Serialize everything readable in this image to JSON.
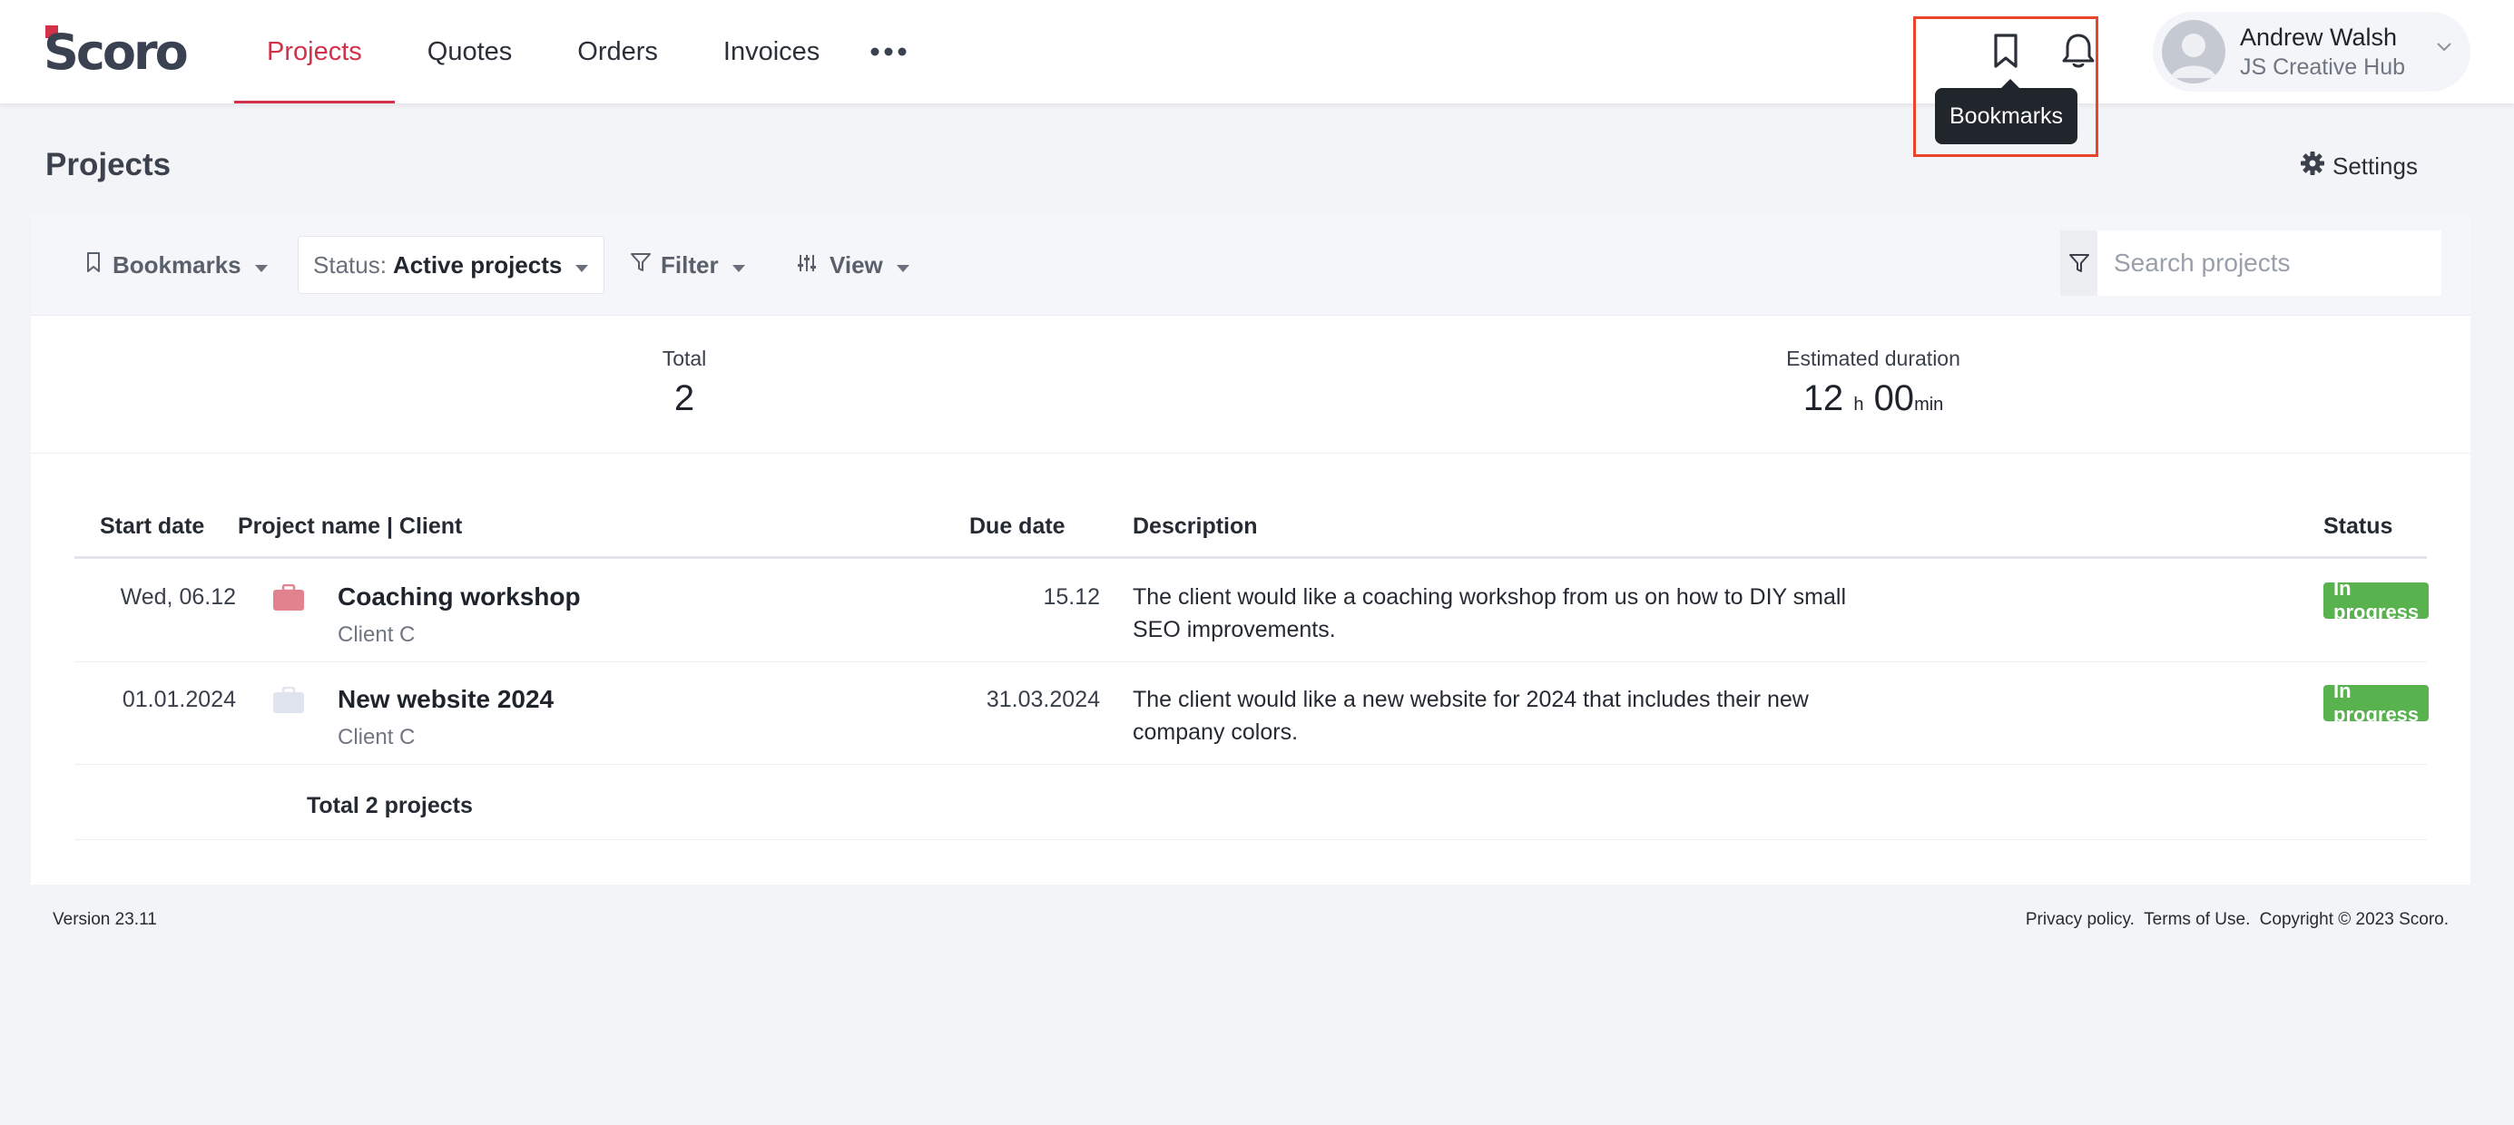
{
  "app": {
    "logo_text": "Scoro",
    "brand_color": "#d2314a"
  },
  "nav": {
    "items": [
      {
        "label": "Projects",
        "active": true
      },
      {
        "label": "Quotes",
        "active": false
      },
      {
        "label": "Orders",
        "active": false
      },
      {
        "label": "Invoices",
        "active": false
      }
    ],
    "more_icon": "more-horizontal-icon"
  },
  "header_actions": {
    "bookmark_icon": "bookmark-icon",
    "bell_icon": "bell-icon",
    "tooltip": "Bookmarks"
  },
  "user": {
    "name": "Andrew Walsh",
    "company": "JS Creative Hub"
  },
  "page": {
    "title": "Projects",
    "settings_label": "Settings"
  },
  "toolbar": {
    "bookmarks_label": "Bookmarks",
    "status_prefix": "Status:",
    "status_value": "Active projects",
    "filter_label": "Filter",
    "view_label": "View",
    "search_placeholder": "Search projects"
  },
  "summary": {
    "total_label": "Total",
    "total_value": "2",
    "duration_label": "Estimated duration",
    "duration_hours": "12",
    "duration_hours_unit": "h",
    "duration_minutes": "00",
    "duration_minutes_unit": "min"
  },
  "table": {
    "headers": {
      "start_date": "Start date",
      "project_client": "Project name | Client",
      "due_date": "Due date",
      "description": "Description",
      "status": "Status"
    },
    "rows": [
      {
        "start_date": "Wed, 06.12",
        "project": "Coaching workshop",
        "client": "Client C",
        "due_date": "15.12",
        "description": "The client would like a coaching workshop from us on how to DIY small SEO improvements.",
        "status": "In progress",
        "icon_color": "#e2828f"
      },
      {
        "start_date": "01.01.2024",
        "project": "New website 2024",
        "client": "Client C",
        "due_date": "31.03.2024",
        "description": "The client would like a new website for 2024 that includes their new company colors.",
        "status": "In progress",
        "icon_color": "#dfe4ee"
      }
    ],
    "total_label": "Total 2 projects"
  },
  "footer": {
    "version": "Version 23.11",
    "privacy": "Privacy policy.",
    "terms": "Terms of Use.",
    "copyright": "Copyright © 2023 Scoro."
  }
}
